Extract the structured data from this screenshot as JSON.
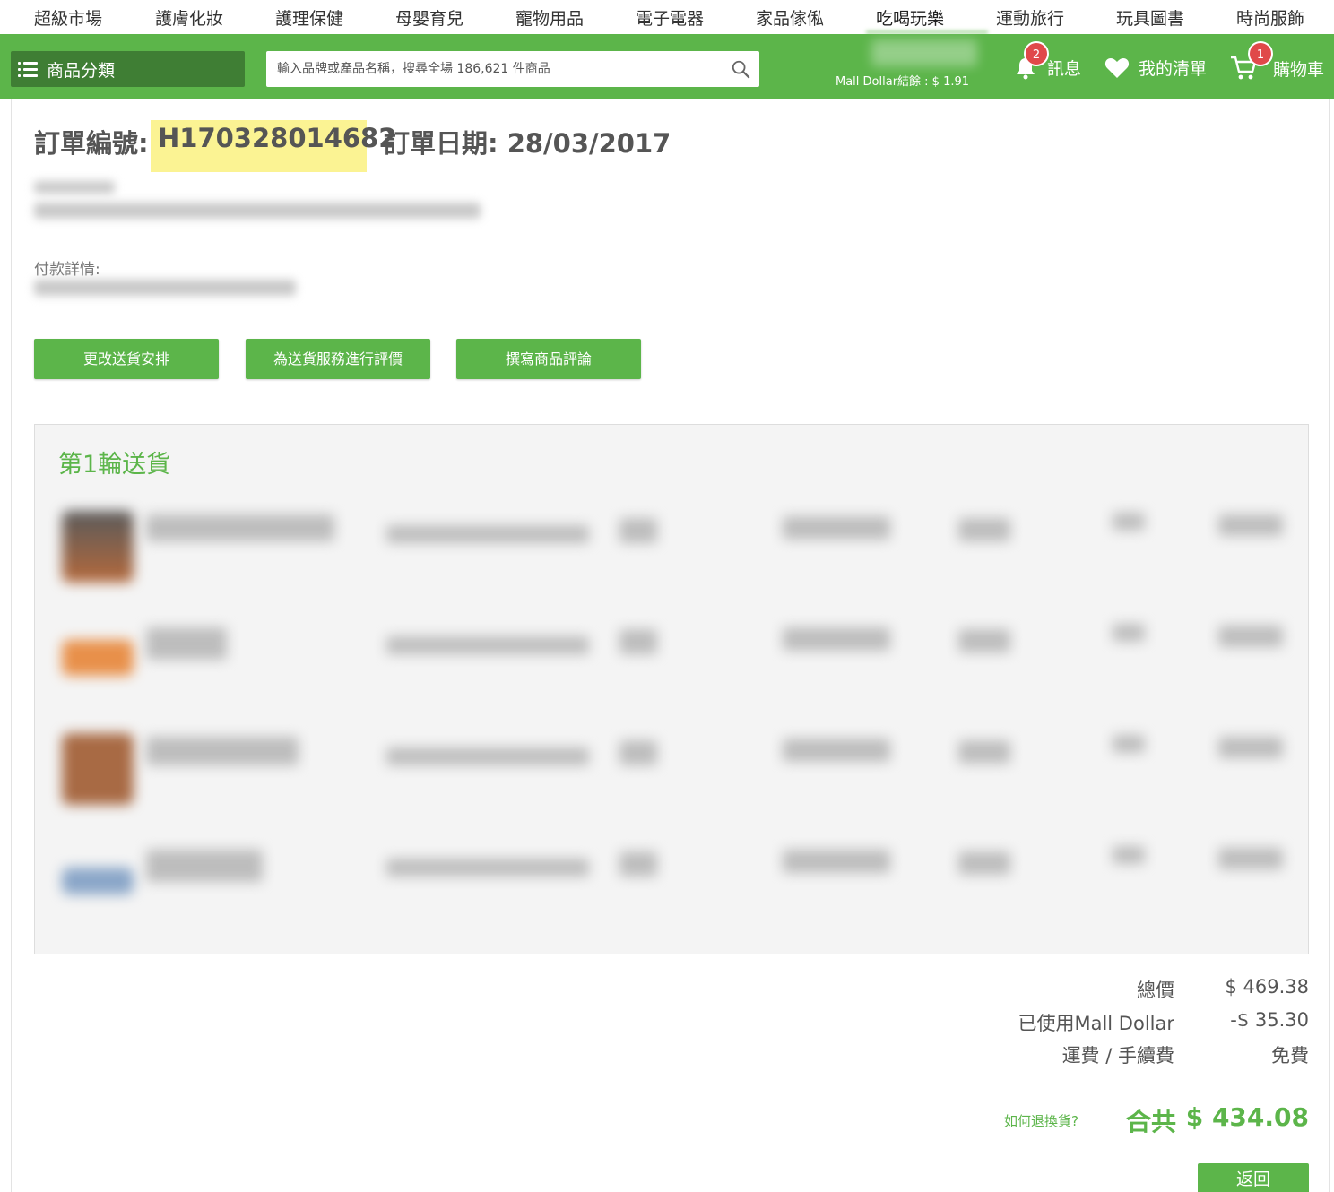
{
  "topnav": {
    "categories": [
      "超級市場",
      "護膚化妝",
      "護理保健",
      "母嬰育兒",
      "寵物用品",
      "電子電器",
      "家品傢俬",
      "吃喝玩樂",
      "運動旅行",
      "玩具圖書",
      "時尚服飾"
    ],
    "active": "吃喝玩樂"
  },
  "header": {
    "category_button": "商品分類",
    "search_placeholder": "輸入品牌或產品名稱，搜尋全場 186,621 件商品",
    "mall_dollar_balance": "Mall Dollar結餘 : $ 1.91",
    "messages_label": "訊息",
    "messages_count": "2",
    "wishlist_label": "我的清單",
    "cart_label": "購物車",
    "cart_count": "1"
  },
  "order": {
    "number_label": "訂單編號:",
    "number": "H170328014682",
    "date_label": "訂單日期: 28/03/2017",
    "payment_label": "付款詳情:"
  },
  "actions": {
    "change_delivery": "更改送貨安排",
    "rate_delivery": "為送貨服務進行評價",
    "write_review": "撰寫商品評論"
  },
  "shipment": {
    "title": "第1輪送貨"
  },
  "summary": {
    "subtotal_label": "總價",
    "subtotal_value": "$ 469.38",
    "mall_dollar_label": "已使用Mall Dollar",
    "mall_dollar_value": "-$ 35.30",
    "shipping_label": "運費 / 手續費",
    "shipping_value": "免費",
    "return_link": "如何退換貨?",
    "total_label": "合共",
    "total_value": "$ 434.08"
  },
  "back_button": "返回",
  "colors": {
    "brand_green": "#5cb54a",
    "dark_green": "#3f7e34",
    "badge_red": "#e0494a",
    "highlight_yellow": "#fbf287"
  }
}
